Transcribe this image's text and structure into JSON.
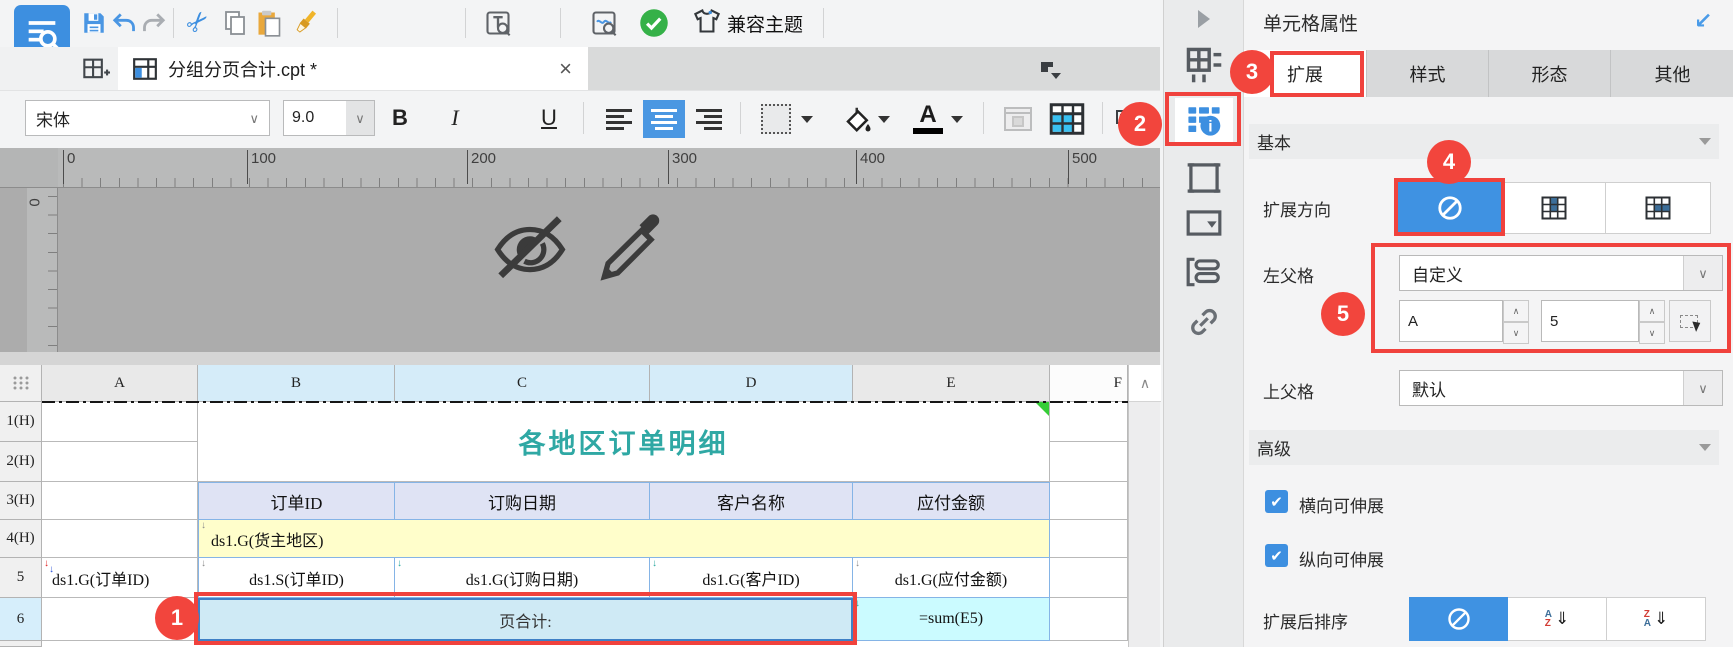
{
  "colors": {
    "accent": "#3d8fe0",
    "annotation_red": "#f2453d",
    "title_teal": "#2fa8a4",
    "group_yellow": "#fffecb",
    "sum_cyan": "#cbfbff",
    "header_lavender": "#dfe3f4",
    "selected_col_blue": "#d5ecf9"
  },
  "toolbar": {
    "compat_theme_label": "兼容主题"
  },
  "tabbar": {
    "tab_title": "分组分页合计.cpt *"
  },
  "formatbar": {
    "font_name": "宋体",
    "font_size": "9.0",
    "bold": "B",
    "italic": "I",
    "underline": "U"
  },
  "ruler": {
    "h": [
      "0",
      "100",
      "200",
      "300",
      "400",
      "500"
    ],
    "v": "0"
  },
  "sheet": {
    "cols": [
      "A",
      "B",
      "C",
      "D",
      "E",
      "F"
    ],
    "rows": [
      "1(H)",
      "2(H)",
      "3(H)",
      "4(H)",
      "5",
      "6"
    ],
    "title": "各地区订单明细",
    "headers": [
      "订单ID",
      "订购日期",
      "客户名称",
      "应付金额"
    ],
    "group_cell": "ds1.G(货主地区)",
    "a5": "ds1.G(订单ID)",
    "b5": "ds1.S(订单ID)",
    "c5": "ds1.G(订购日期)",
    "d5": "ds1.G(客户ID)",
    "e5": "ds1.G(应付金额)",
    "page_total": "页合计:",
    "sum_formula": "=sum(E5)"
  },
  "panel": {
    "title": "单元格属性",
    "tabs": [
      "扩展",
      "样式",
      "形态",
      "其他"
    ],
    "basic_section": "基本",
    "expand_direction_label": "扩展方向",
    "left_parent_label": "左父格",
    "left_parent_mode": "自定义",
    "left_parent_col": "A",
    "left_parent_row": "5",
    "up_parent_label": "上父格",
    "up_parent_mode": "默认",
    "advanced_section": "高级",
    "h_expandable_label": "横向可伸展",
    "v_expandable_label": "纵向可伸展",
    "sort_after_label": "扩展后排序",
    "sort_a": "A",
    "sort_z": "Z"
  },
  "annotations": {
    "n1": "1",
    "n2": "2",
    "n3": "3",
    "n4": "4",
    "n5": "5"
  },
  "icons": {
    "chevron_down": "∨",
    "spin_up": "∧",
    "spin_down": "∨",
    "scroll_up": "∧",
    "check": "✔",
    "close": "×",
    "cut": "✂",
    "collapse_panel": "↙",
    "sort_arrow": "⇓",
    "expand_marker": "↓"
  }
}
